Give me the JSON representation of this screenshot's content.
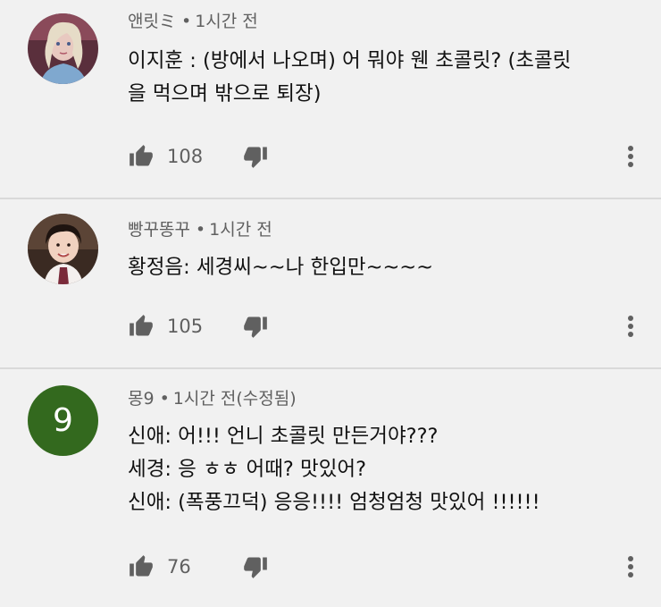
{
  "colors": {
    "background": "#f1f1f1",
    "text_primary": "#111111",
    "text_secondary": "#606060",
    "icon": "#606060",
    "letter_avatar_bg": "#33691e"
  },
  "comments": [
    {
      "author": "앤릿ミ",
      "time": "1시간 전",
      "text": "이지훈 : (방에서 나오며) 어 뭐야 웬 초콜릿? (초콜릿\n을 먹으며 밖으로 퇴장)",
      "likes": "108",
      "avatar": "elsa-avatar-icon"
    },
    {
      "author": "빵꾸똥꾸",
      "time": "1시간 전",
      "text": "황정음: 세경씨~~나 한입만~~~~",
      "likes": "105",
      "avatar": "girl-avatar-icon"
    },
    {
      "author": "몽9",
      "time": "1시간 전(수정됨)",
      "text": "신애: 어!!! 언니 초콜릿 만든거야???\n세경: 응 ㅎㅎ 어때? 맛있어?\n신애: (폭풍끄덕) 응응!!!! 엄청엄청 맛있어 !!!!!!",
      "likes": "76",
      "avatar_letter": "9"
    }
  ],
  "icons": {
    "like": "thumbs-up-icon",
    "dislike": "thumbs-down-icon",
    "more": "more-vertical-icon"
  }
}
